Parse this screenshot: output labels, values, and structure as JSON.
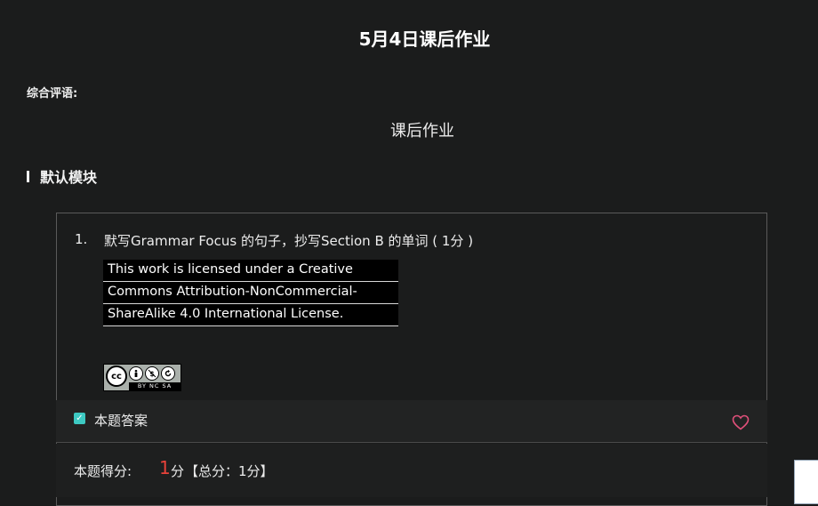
{
  "page": {
    "title": "5月4日课后作业"
  },
  "comment": {
    "label": "综合评语:"
  },
  "section": {
    "title": "课后作业"
  },
  "module": {
    "title": "默认模块"
  },
  "question": {
    "number": "1.",
    "text": "默写Grammar Focus 的句子，抄写Section B 的单词 ( 1分 )",
    "license_lines": [
      "This work is licensed under a Creative",
      "Commons Attribution-NonCommercial-",
      "ShareAlike 4.0 International License."
    ],
    "badge": {
      "main": "cc",
      "strip": "BY NC SA"
    }
  },
  "answer": {
    "label": "本题答案",
    "checked": true,
    "check_color": "#3dc9c2",
    "heart_color": "#e0507a"
  },
  "score": {
    "label": "本题得分:",
    "value": "1",
    "unit": "分",
    "total": "【总分：1分】",
    "value_color": "#e8423a"
  }
}
